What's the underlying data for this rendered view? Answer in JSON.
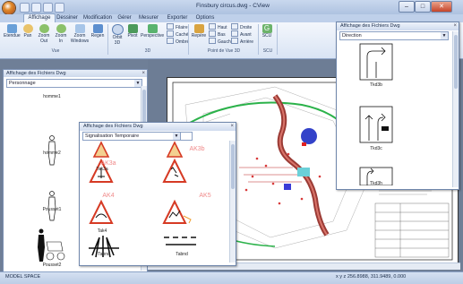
{
  "window": {
    "title": "Finsbury circus.dwg - CView",
    "minimize": "–",
    "maximize": "□",
    "close": "✕"
  },
  "ribbon": {
    "tabs": [
      "Affichage",
      "Dessiner",
      "Modification",
      "Gérer",
      "Mesurer",
      "Exporter",
      "Options"
    ],
    "active_tab": "Affichage",
    "buttons": {
      "etendue": "Etendue",
      "pan": "Pan",
      "zoom_out": "Zoom\nOut",
      "zoom_in": "Zoom\nIn",
      "zoom_windows": "Zoom\nWindows",
      "regen": "Regen",
      "orbit": "Orbit\n3D",
      "pivot": "Pivot",
      "perspective": "Perspective",
      "filaire": "Filaire",
      "cache": "Caché",
      "ombre": "Ombré",
      "repere": "Repère",
      "haut": "Haut",
      "bas": "Bas",
      "gauche": "Gauche",
      "droite": "Droite",
      "avant": "Avant",
      "arriere": "Arrière",
      "scu": "SCU"
    },
    "groups": {
      "view": "Vue",
      "threed": "3D",
      "point_de_vue": "Point de Vue 3D",
      "scu": "SCU"
    }
  },
  "left_panel": {
    "title": "Affichage des Fichiers Dwg",
    "category": "Personnage",
    "items": [
      "homme1",
      "homme2",
      "Pousset1",
      "Pousset2"
    ]
  },
  "mid_window": {
    "title": "Affichage des Fichiers Dwg",
    "category": "Signalisation Temporaire",
    "items": [
      {
        "label": "Tak3a",
        "sign": "AK3a"
      },
      {
        "label": "",
        "sign": "AK3b"
      },
      {
        "label": "Tak4",
        "sign": "AK4"
      },
      {
        "label": "",
        "sign": "AK5"
      },
      {
        "label": "Tabnd",
        "sign": ""
      },
      {
        "label": "Tabnd",
        "sign": ""
      }
    ]
  },
  "right_window": {
    "title": "Affichage des Fichiers Dwg",
    "category": "Direction",
    "items": [
      "Tkd3b",
      "Tkd3c",
      "Tkd3h"
    ]
  },
  "status": {
    "space": "MODEL SPACE",
    "coords": "x y z 256.8988, 311.9489, 0.000"
  },
  "colors": {
    "ribbon_bg": "#dce6f4",
    "drawing_bg": "#6d7d95",
    "sign_red": "#d63a24",
    "sign_orange": "#f0a030"
  }
}
